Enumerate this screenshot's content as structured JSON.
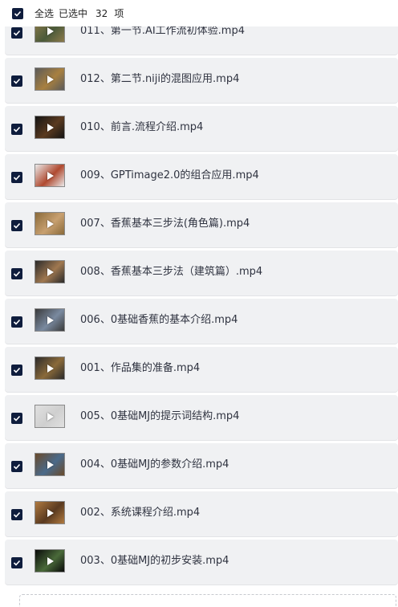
{
  "header": {
    "select_all_label": "全选",
    "selected_prefix": "已选中",
    "selected_count": "32",
    "selected_suffix": "项"
  },
  "files": [
    {
      "name": "011、第一节.AI工作流初体验.mp4",
      "thumb_color": "#8c7a4a",
      "thumb_accent": "#4b5a3a",
      "checked": true
    },
    {
      "name": "012、第二节.niji的混图应用.mp4",
      "thumb_color": "#5a5a5a",
      "thumb_accent": "#a88040",
      "checked": true
    },
    {
      "name": "010、前言.流程介绍.mp4",
      "thumb_color": "#141414",
      "thumb_accent": "#5a3a20",
      "checked": true
    },
    {
      "name": "009、GPTimage2.0的组合应用.mp4",
      "thumb_color": "#eaeaea",
      "thumb_accent": "#b04a30",
      "checked": true
    },
    {
      "name": "007、香蕉基本三步法(角色篇).mp4",
      "thumb_color": "#8a6a3a",
      "thumb_accent": "#c8a070",
      "checked": true
    },
    {
      "name": "008、香蕉基本三步法（建筑篇）.mp4",
      "thumb_color": "#2a2a2a",
      "thumb_accent": "#a07850",
      "checked": true
    },
    {
      "name": "006、0基础香蕉的基本介绍.mp4",
      "thumb_color": "#3a3a3a",
      "thumb_accent": "#7a8aa0",
      "checked": true
    },
    {
      "name": "001、作品集的准备.mp4",
      "thumb_color": "#2a2a2a",
      "thumb_accent": "#8a6a3a",
      "checked": true
    },
    {
      "name": "005、0基础MJ的提示词结构.mp4",
      "thumb_color": "#e0e0e0",
      "thumb_accent": "#cfcfcf",
      "checked": true
    },
    {
      "name": "004、0基础MJ的参数介绍.mp4",
      "thumb_color": "#6a4a2a",
      "thumb_accent": "#4a6a8a",
      "checked": true
    },
    {
      "name": "002、系统课程介绍.mp4",
      "thumb_color": "#b07a40",
      "thumb_accent": "#5a3a20",
      "checked": true
    },
    {
      "name": "003、0基础MJ的初步安装.mp4",
      "thumb_color": "#0a0a0a",
      "thumb_accent": "#4a6a3a",
      "checked": true
    }
  ]
}
